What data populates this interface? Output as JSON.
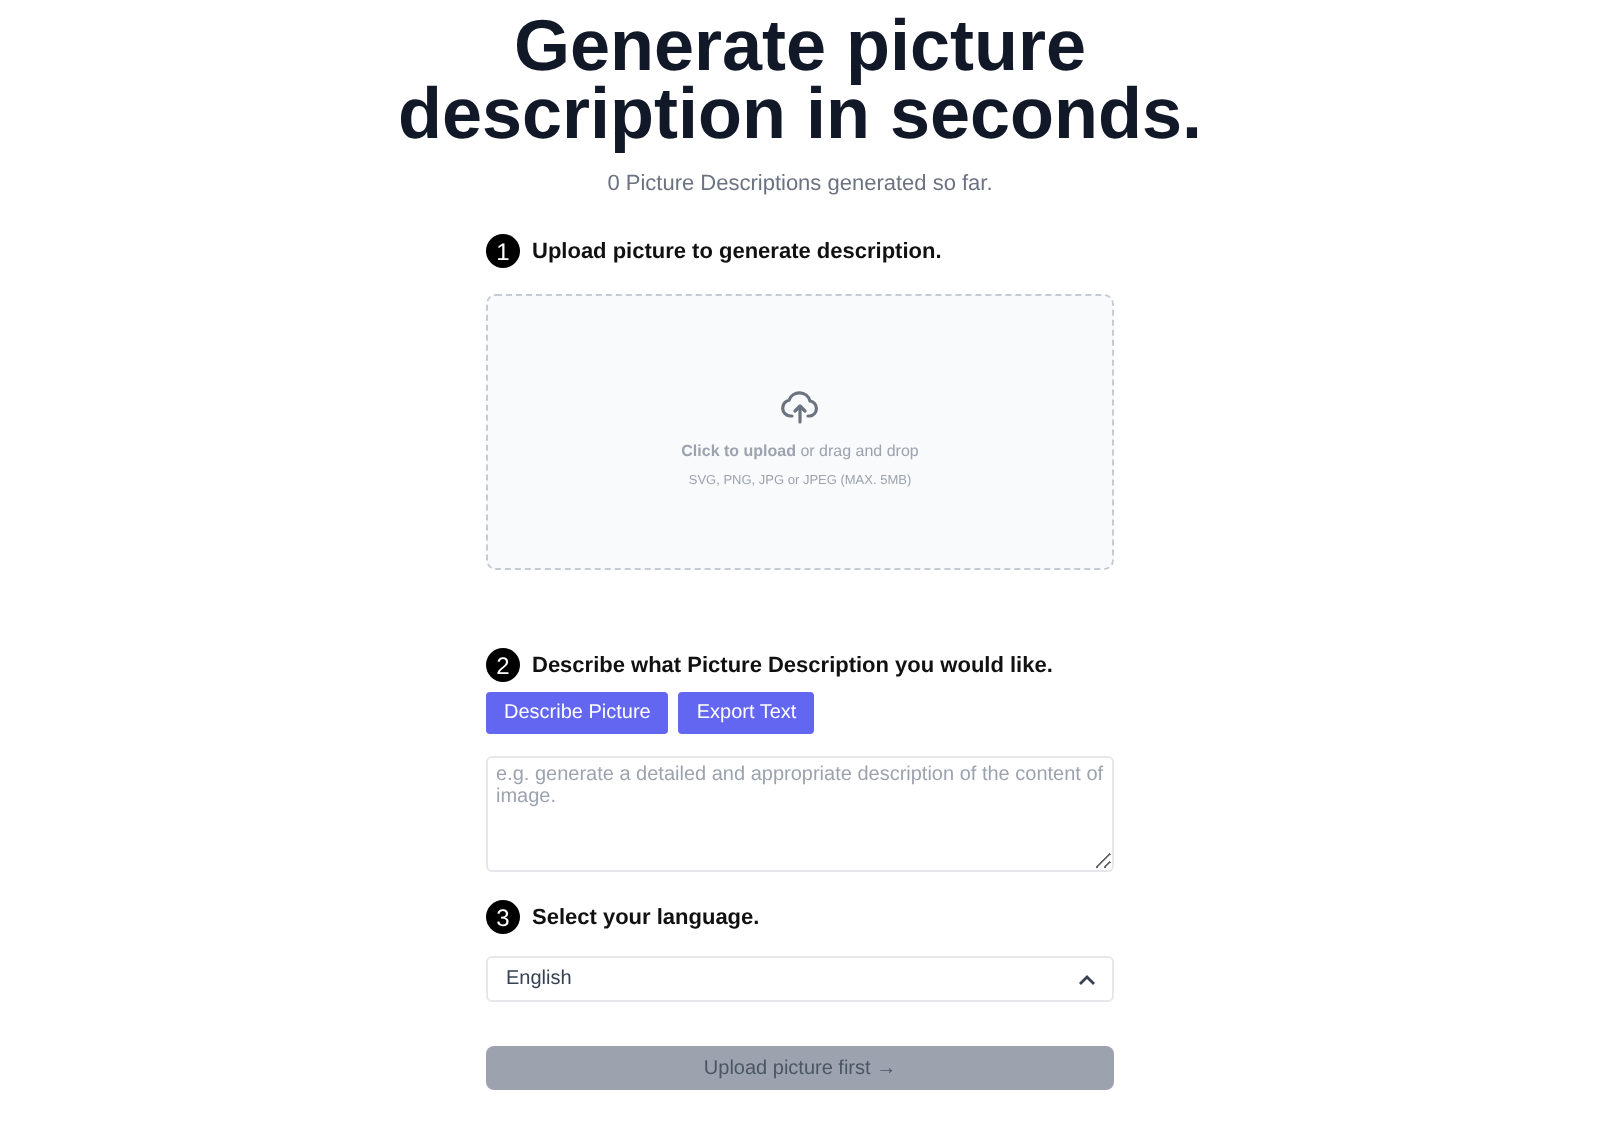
{
  "title": "Generate picture description in seconds.",
  "counter": "0 Picture Descriptions generated so far.",
  "steps": [
    {
      "number": "1",
      "label": "Upload picture to generate description."
    },
    {
      "number": "2",
      "label": "Describe what Picture Description you would like."
    },
    {
      "number": "3",
      "label": "Select your language."
    }
  ],
  "upload": {
    "prompt": "**Click to upload** or drag and drop",
    "hint": "SVG, PNG, JPG or JPEG (MAX. 5MB)"
  },
  "mode_buttons": [
    "Describe Picture",
    "Export Text"
  ],
  "prompt_field": {
    "placeholder": "e.g. generate a detailed and appropriate description of the content of image."
  },
  "language": {
    "value": "English",
    "expanded": true
  },
  "submit": {
    "label": "Upload picture first →",
    "disabled": true
  }
}
